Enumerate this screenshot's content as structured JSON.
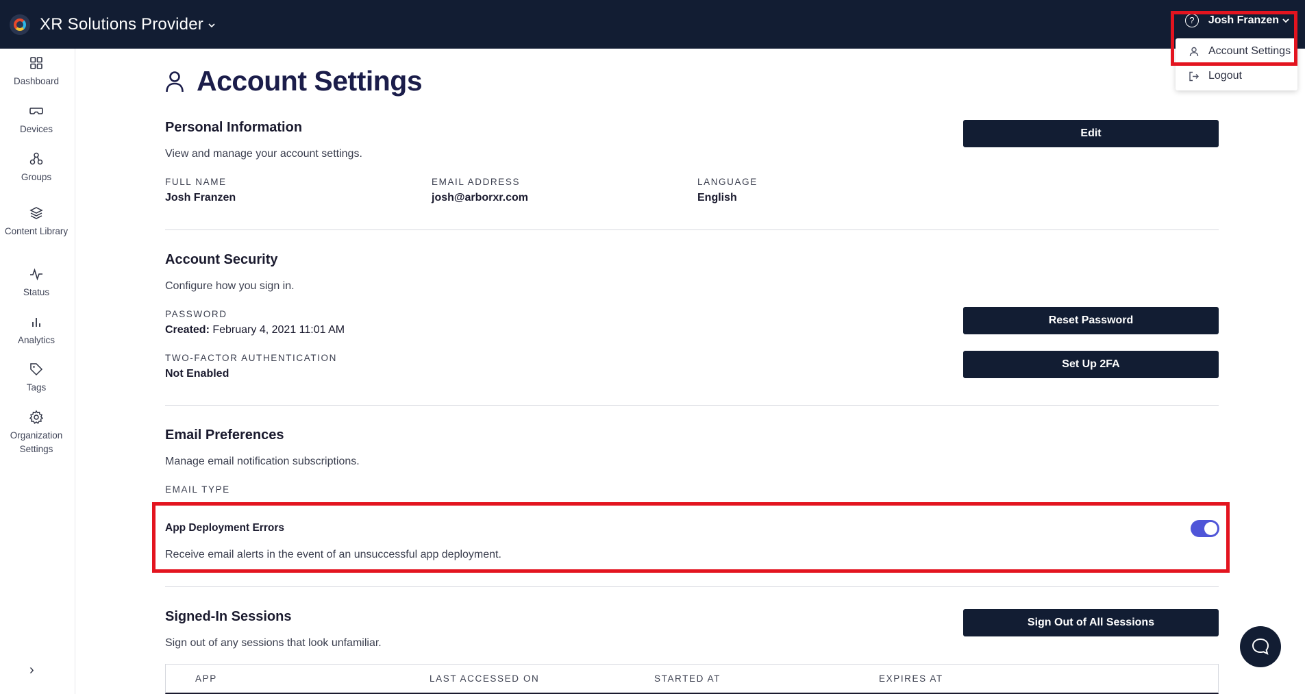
{
  "header": {
    "org_name": "XR Solutions Provider",
    "user_name": "Josh Franzen",
    "colors": {
      "bar": "#121d33",
      "highlight": "#e3141f"
    }
  },
  "user_menu": {
    "items": [
      {
        "label": "Account Settings",
        "icon": "user-icon"
      },
      {
        "label": "Logout",
        "icon": "logout-icon"
      }
    ]
  },
  "sidebar": {
    "items": [
      {
        "label": "Dashboard",
        "icon": "dashboard-grid-icon"
      },
      {
        "label": "Devices",
        "icon": "vr-headset-icon"
      },
      {
        "label": "Groups",
        "icon": "groups-icon"
      },
      {
        "label": "Content Library",
        "icon": "layers-icon"
      },
      {
        "label": "Status",
        "icon": "activity-icon"
      },
      {
        "label": "Analytics",
        "icon": "bar-chart-icon"
      },
      {
        "label": "Tags",
        "icon": "tag-icon"
      },
      {
        "label": "Organization Settings",
        "icon": "gear-icon"
      }
    ],
    "expand_glyph": "›"
  },
  "page": {
    "title": "Account Settings"
  },
  "personal_info": {
    "title": "Personal Information",
    "subtitle": "View and manage your account settings.",
    "edit_label": "Edit",
    "full_name_label": "FULL NAME",
    "full_name": "Josh Franzen",
    "email_label": "EMAIL ADDRESS",
    "email": "josh@arborxr.com",
    "language_label": "LANGUAGE",
    "language": "English"
  },
  "account_security": {
    "title": "Account Security",
    "subtitle": "Configure how you sign in.",
    "password_label": "PASSWORD",
    "created_label": "Created:",
    "created_value": "February 4, 2021 11:01 AM",
    "reset_label": "Reset Password",
    "twofa_label": "TWO-FACTOR AUTHENTICATION",
    "twofa_value": "Not Enabled",
    "setup_2fa_label": "Set Up 2FA"
  },
  "email_prefs": {
    "title": "Email Preferences",
    "subtitle": "Manage email notification subscriptions.",
    "type_label": "EMAIL TYPE",
    "item_title": "App Deployment Errors",
    "item_desc": "Receive email alerts in the event of an unsuccessful app deployment.",
    "enabled": true,
    "toggle_color": "#4f55d8"
  },
  "sessions": {
    "title": "Signed-In Sessions",
    "subtitle": "Sign out of any sessions that look unfamiliar.",
    "sign_out_all_label": "Sign Out of All Sessions",
    "columns": [
      "APP",
      "LAST ACCESSED ON",
      "STARTED AT",
      "EXPIRES AT"
    ]
  }
}
